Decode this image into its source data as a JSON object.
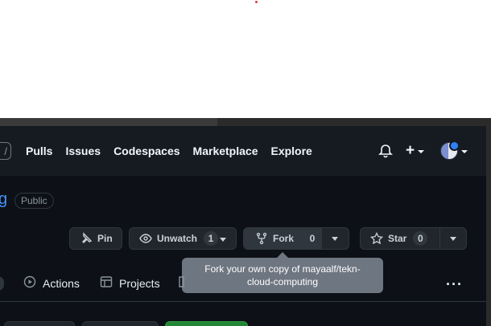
{
  "header": {
    "search_stub_text": "/",
    "nav": [
      "Pulls",
      "Issues",
      "Codespaces",
      "Marketplace",
      "Explore"
    ],
    "plus_label": "+"
  },
  "repo": {
    "name_fragment": "g",
    "visibility": "Public"
  },
  "actions": {
    "pin_label": "Pin",
    "unwatch_label": "Unwatch",
    "unwatch_count": "1",
    "fork_label": "Fork",
    "fork_count": "0",
    "star_label": "Star",
    "star_count": "0"
  },
  "tooltip": {
    "text": "Fork your own copy of mayaalf/tekn-cloud-computing"
  },
  "tabs": {
    "actions": "Actions",
    "projects": "Projects",
    "more": "···"
  },
  "colors": {
    "background": "#0d1117",
    "header": "#161b22",
    "link": "#4493f8",
    "tooltip": "#6e7681",
    "primary_button": "#238636"
  },
  "icons": [
    "bell-icon",
    "plus-icon",
    "pin-icon",
    "eye-icon",
    "repo-forked-icon",
    "star-icon",
    "play-icon",
    "table-icon",
    "kebab-icon"
  ]
}
